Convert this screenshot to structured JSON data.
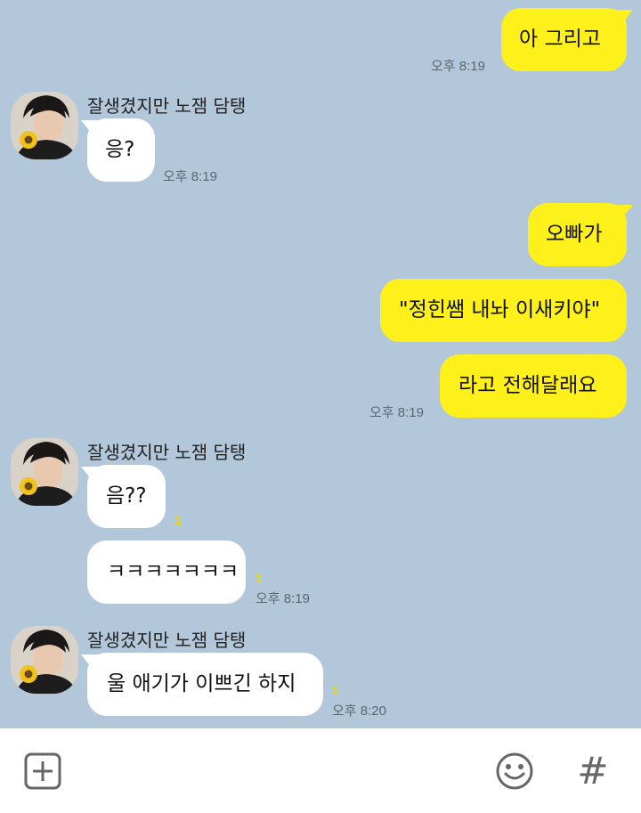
{
  "messages": [
    {
      "from": "me",
      "text": "아 그리고",
      "time": "오후 8:19"
    },
    {
      "from": "other",
      "sender": "잘생겼지만 노잼 담탱",
      "text": "응?",
      "time": "오후 8:19"
    },
    {
      "from": "me",
      "text": "오빠가"
    },
    {
      "from": "me",
      "text": "\"정힌쌤 내놔 이새키야\""
    },
    {
      "from": "me",
      "text": "라고 전해달래요",
      "time": "오후 8:19"
    },
    {
      "from": "other",
      "sender": "잘생겼지만 노잼 담탱",
      "text": "음??",
      "unread": "1"
    },
    {
      "from": "other",
      "text": "ㅋㅋㅋㅋㅋㅋㅋ",
      "unread": "1",
      "time": "오후 8:19"
    },
    {
      "from": "other",
      "sender": "잘생겼지만 노잼 담탱",
      "text": "울 애기가 이쁘긴 하지",
      "unread": "1",
      "time": "오후 8:20"
    }
  ],
  "input_bar": {
    "add_icon": "plus-square-icon",
    "emoji_icon": "smiley-icon",
    "hashtag_icon": "hashtag-icon",
    "hashtag_glyph": "#"
  },
  "colors": {
    "chat_background": "#b2c7d9",
    "my_bubble": "#fef01b",
    "other_bubble": "#ffffff",
    "unread_count": "#ecd700"
  }
}
